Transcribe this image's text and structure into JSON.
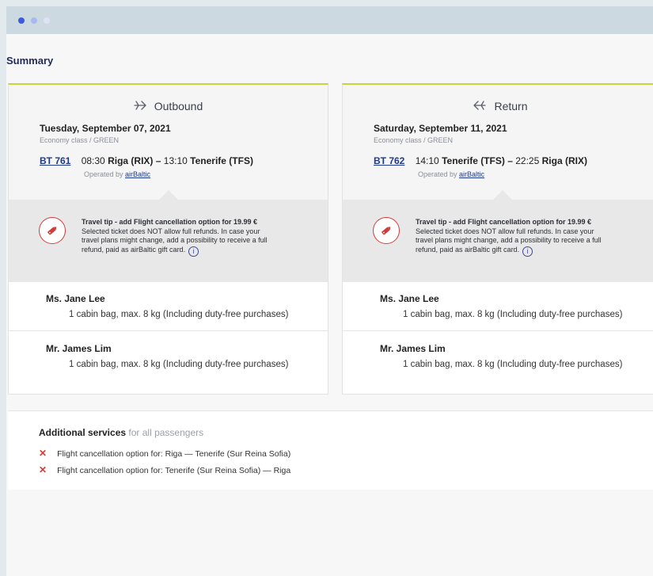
{
  "window": {
    "dots": [
      "#3b5bdb",
      "#a9b9ef",
      "#dde3f5"
    ]
  },
  "summary": {
    "title": "Summary"
  },
  "outbound": {
    "direction": "Outbound",
    "date": "Tuesday, September 07, 2021",
    "class": "Economy class / GREEN",
    "flight_no": "BT 761",
    "dep_time": "08:30",
    "dep_city": "Riga (RIX)",
    "dash": "–",
    "arr_time": "13:10",
    "arr_city": "Tenerife (TFS)",
    "operated_by_label": "Operated by",
    "operator": "airBaltic",
    "tip_title": "Travel tip - add Flight cancellation option for 19.99 €",
    "tip_line1": "Selected ticket does NOT allow full refunds. In case your",
    "tip_line2": "travel plans might change, add a possibility to receive a full",
    "tip_line3": "refund, paid as airBaltic gift card.",
    "passengers": [
      {
        "name": "Ms. Jane Lee",
        "bag": "1 cabin bag, max. 8 kg (Including duty-free purchases)"
      },
      {
        "name": "Mr. James Lim",
        "bag": "1 cabin bag, max. 8 kg (Including duty-free purchases)"
      }
    ]
  },
  "return": {
    "direction": "Return",
    "date": "Saturday, September 11, 2021",
    "class": "Economy class / GREEN",
    "flight_no": "BT 762",
    "dep_time": "14:10",
    "dep_city": "Tenerife (TFS)",
    "dash": "–",
    "arr_time": "22:25",
    "arr_city": "Riga (RIX)",
    "operated_by_label": "Operated by",
    "operator": "airBaltic",
    "tip_title": "Travel tip - add Flight cancellation option for 19.99 €",
    "tip_line1": "Selected ticket does NOT allow full refunds. In case your",
    "tip_line2": "travel plans might change, add a possibility to receive a full",
    "tip_line3": "refund, paid as airBaltic gift card.",
    "passengers": [
      {
        "name": "Ms. Jane Lee",
        "bag": "1 cabin bag, max. 8 kg (Including duty-free purchases)"
      },
      {
        "name": "Mr. James Lim",
        "bag": "1 cabin bag, max. 8 kg (Including duty-free purchases)"
      }
    ]
  },
  "additional": {
    "title": "Additional services",
    "subtitle": "for all passengers",
    "items": [
      "Flight cancellation option for: Riga — Tenerife (Sur Reina Sofia)",
      "Flight cancellation option for: Tenerife (Sur Reina Sofia) — Riga"
    ]
  },
  "icons": {
    "outbound": "plane-right-icon",
    "return": "plane-left-icon",
    "tip": "tag-icon",
    "info": "info-icon",
    "remove": "x-icon"
  },
  "colors": {
    "accent_green": "#c5d63a",
    "link_blue": "#1f3a8a",
    "danger": "#d33b3b"
  }
}
